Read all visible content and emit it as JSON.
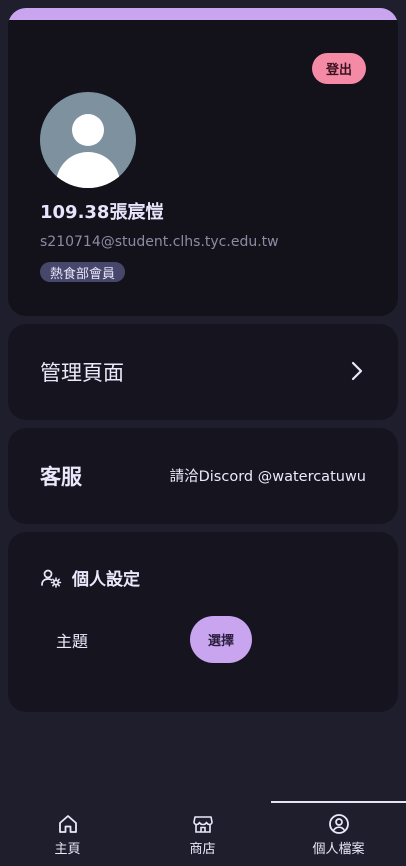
{
  "profile": {
    "logout_label": "登出",
    "name": "109.38張宸愷",
    "email": "s210714@student.clhs.tyc.edu.tw",
    "role": "熱食部會員",
    "avatar_icon": "default-user-avatar",
    "accent_color": "#c9a4ef"
  },
  "admin": {
    "title": "管理頁面",
    "icon": "chevron-right-icon"
  },
  "support": {
    "title": "客服",
    "contact": "請洽Discord @watercatuwu"
  },
  "settings": {
    "title": "個人設定",
    "icon": "user-gear-icon",
    "theme_label": "主題",
    "theme_button": "選擇"
  },
  "nav": {
    "items": [
      {
        "label": "主頁",
        "icon": "home-icon"
      },
      {
        "label": "商店",
        "icon": "store-icon"
      },
      {
        "label": "個人檔案",
        "icon": "user-circle-icon"
      }
    ],
    "active": "個人檔案"
  }
}
